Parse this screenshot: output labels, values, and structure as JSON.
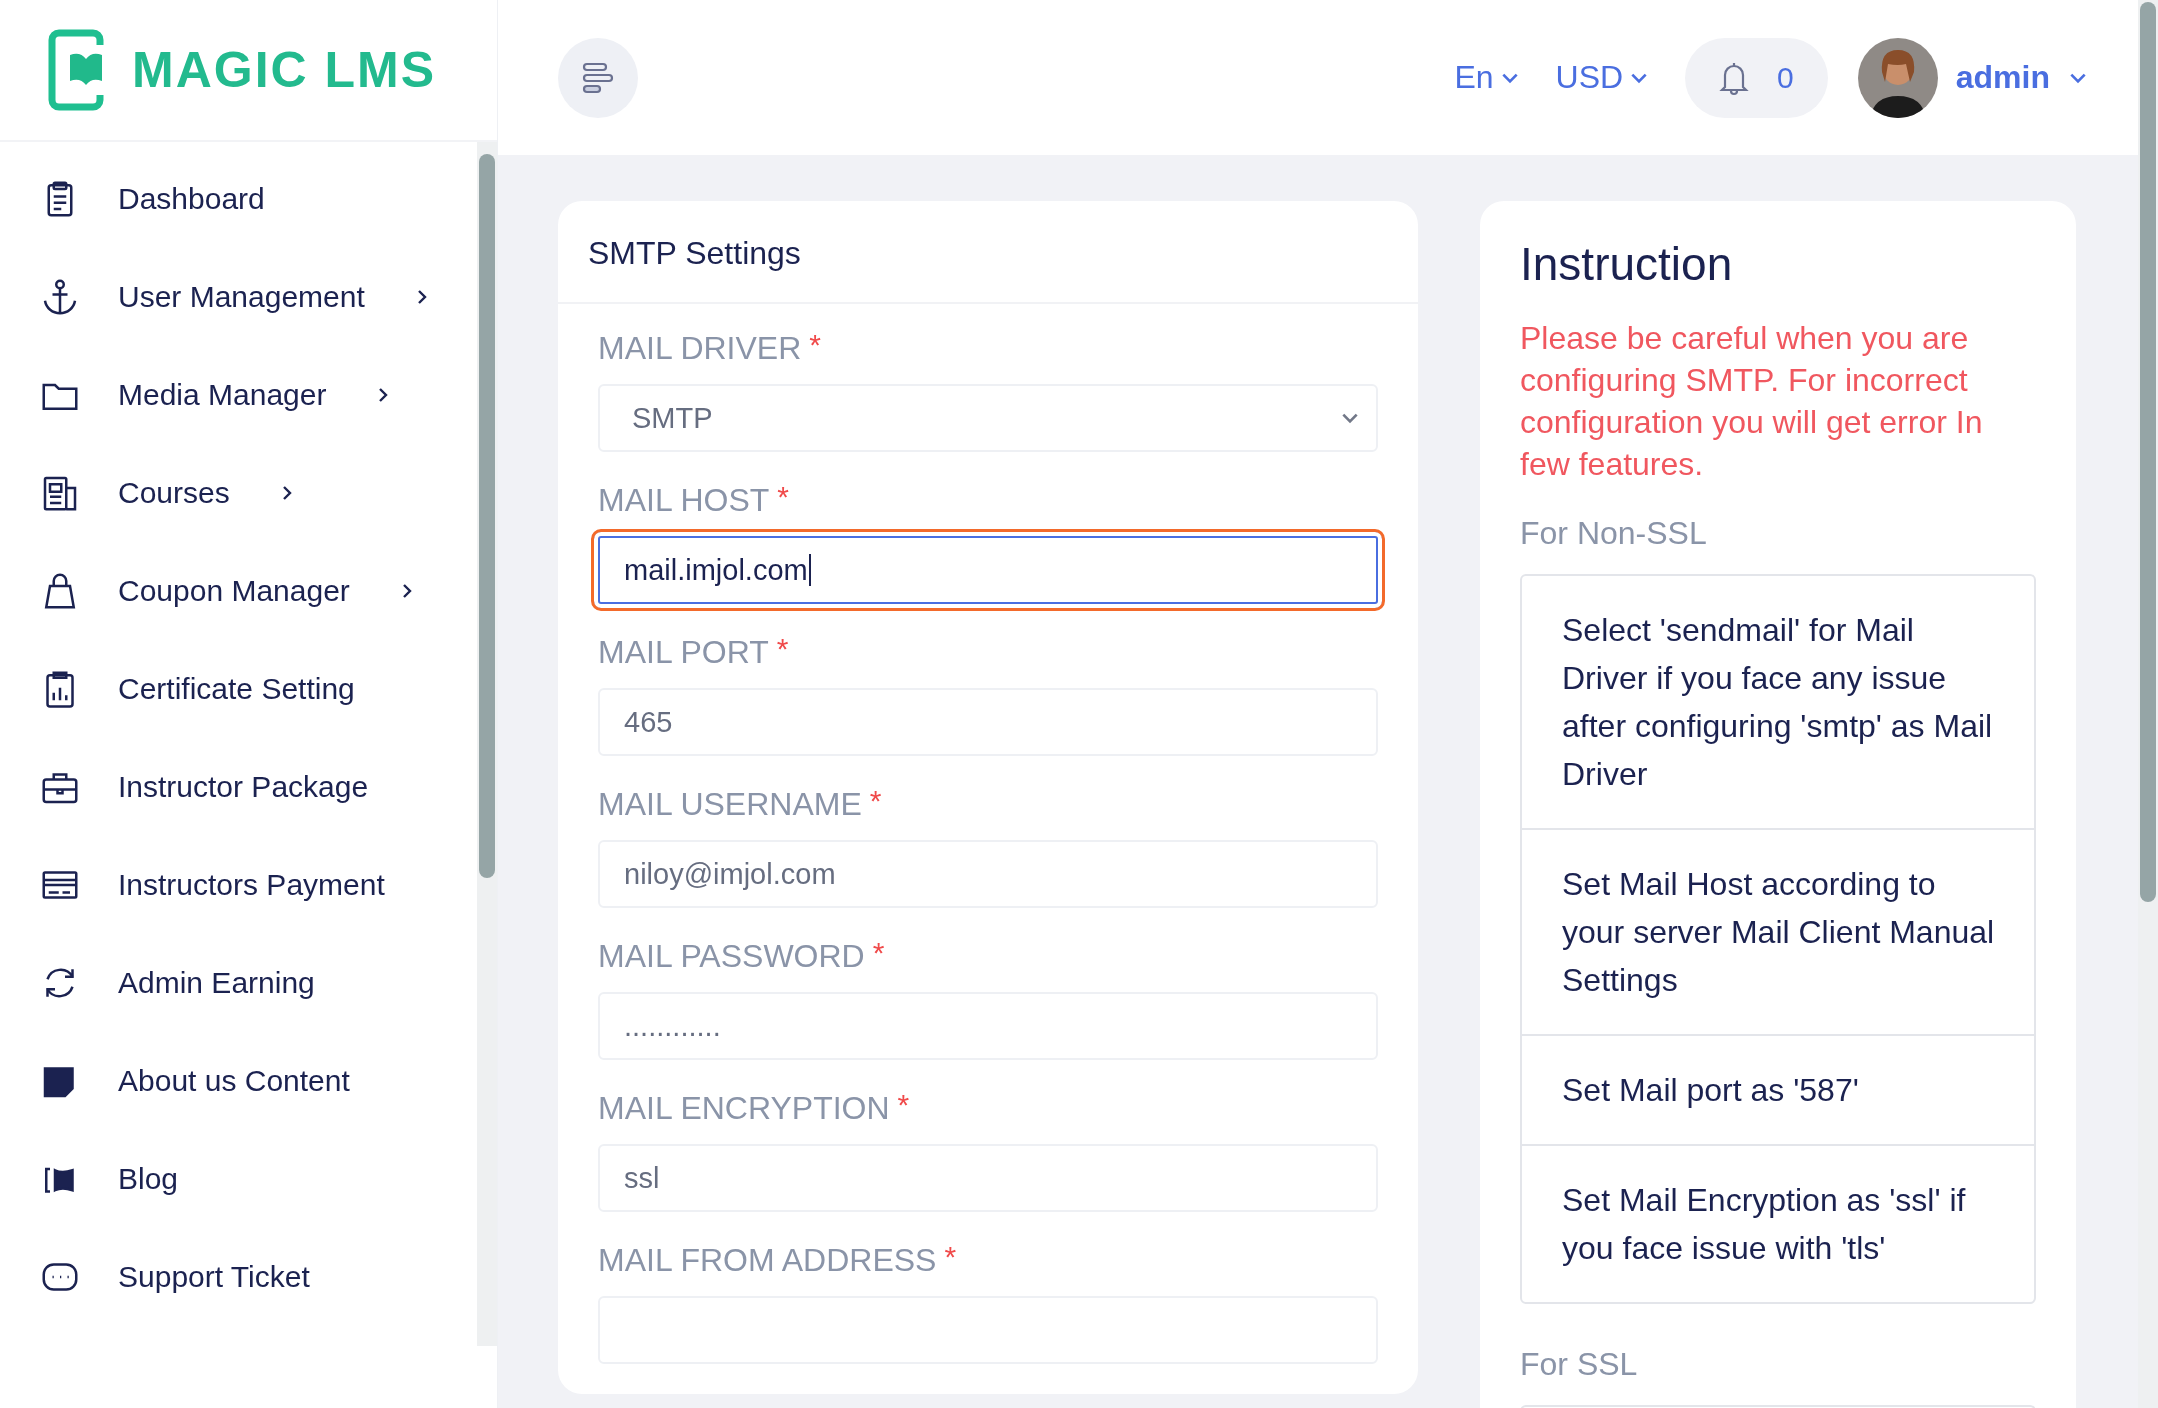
{
  "brand": {
    "name": "MAGIC LMS"
  },
  "header": {
    "language": "En",
    "currency": "USD",
    "notification_count": "0",
    "user": "admin"
  },
  "sidebar": {
    "items": [
      {
        "label": "Dashboard",
        "has_submenu": false
      },
      {
        "label": "User Management",
        "has_submenu": true
      },
      {
        "label": "Media Manager",
        "has_submenu": true
      },
      {
        "label": "Courses",
        "has_submenu": true
      },
      {
        "label": "Coupon Manager",
        "has_submenu": true
      },
      {
        "label": "Certificate Setting",
        "has_submenu": false
      },
      {
        "label": "Instructor Package",
        "has_submenu": false
      },
      {
        "label": "Instructors Payment",
        "has_submenu": false
      },
      {
        "label": "Admin Earning",
        "has_submenu": false
      },
      {
        "label": "About us Content",
        "has_submenu": false
      },
      {
        "label": "Blog",
        "has_submenu": false
      },
      {
        "label": "Support Ticket",
        "has_submenu": false
      }
    ]
  },
  "smtp_form": {
    "title": "SMTP Settings",
    "fields": [
      {
        "label": "MAIL DRIVER",
        "required_mark": "*",
        "kind": "select",
        "value": "SMTP",
        "focused": false
      },
      {
        "label": "MAIL HOST",
        "required_mark": "*",
        "kind": "text",
        "value": "mail.imjol.com",
        "focused": true
      },
      {
        "label": "MAIL PORT",
        "required_mark": "*",
        "kind": "text",
        "value": "465",
        "focused": false
      },
      {
        "label": "MAIL USERNAME",
        "required_mark": "*",
        "kind": "text",
        "value": "niloy@imjol.com",
        "focused": false
      },
      {
        "label": "MAIL PASSWORD",
        "required_mark": "*",
        "kind": "text",
        "value": "............",
        "focused": false
      },
      {
        "label": "MAIL ENCRYPTION",
        "required_mark": "*",
        "kind": "text",
        "value": "ssl",
        "focused": false
      },
      {
        "label": "MAIL FROM ADDRESS",
        "required_mark": "*",
        "kind": "text",
        "focused": false
      }
    ]
  },
  "instruction": {
    "title": "Instruction",
    "warning": "Please be careful when you are configuring SMTP. For incorrect configuration you will get error In few features.",
    "sections": [
      {
        "heading": "For Non-SSL",
        "items": [
          "Select 'sendmail' for Mail Driver if you face any issue after configuring 'smtp' as Mail Driver",
          "Set Mail Host according to your server Mail Client Manual Settings",
          "Set Mail port as '587'",
          "Set Mail Encryption as 'ssl' if you face issue with 'tls'"
        ]
      },
      {
        "heading": "For SSL"
      }
    ]
  }
}
